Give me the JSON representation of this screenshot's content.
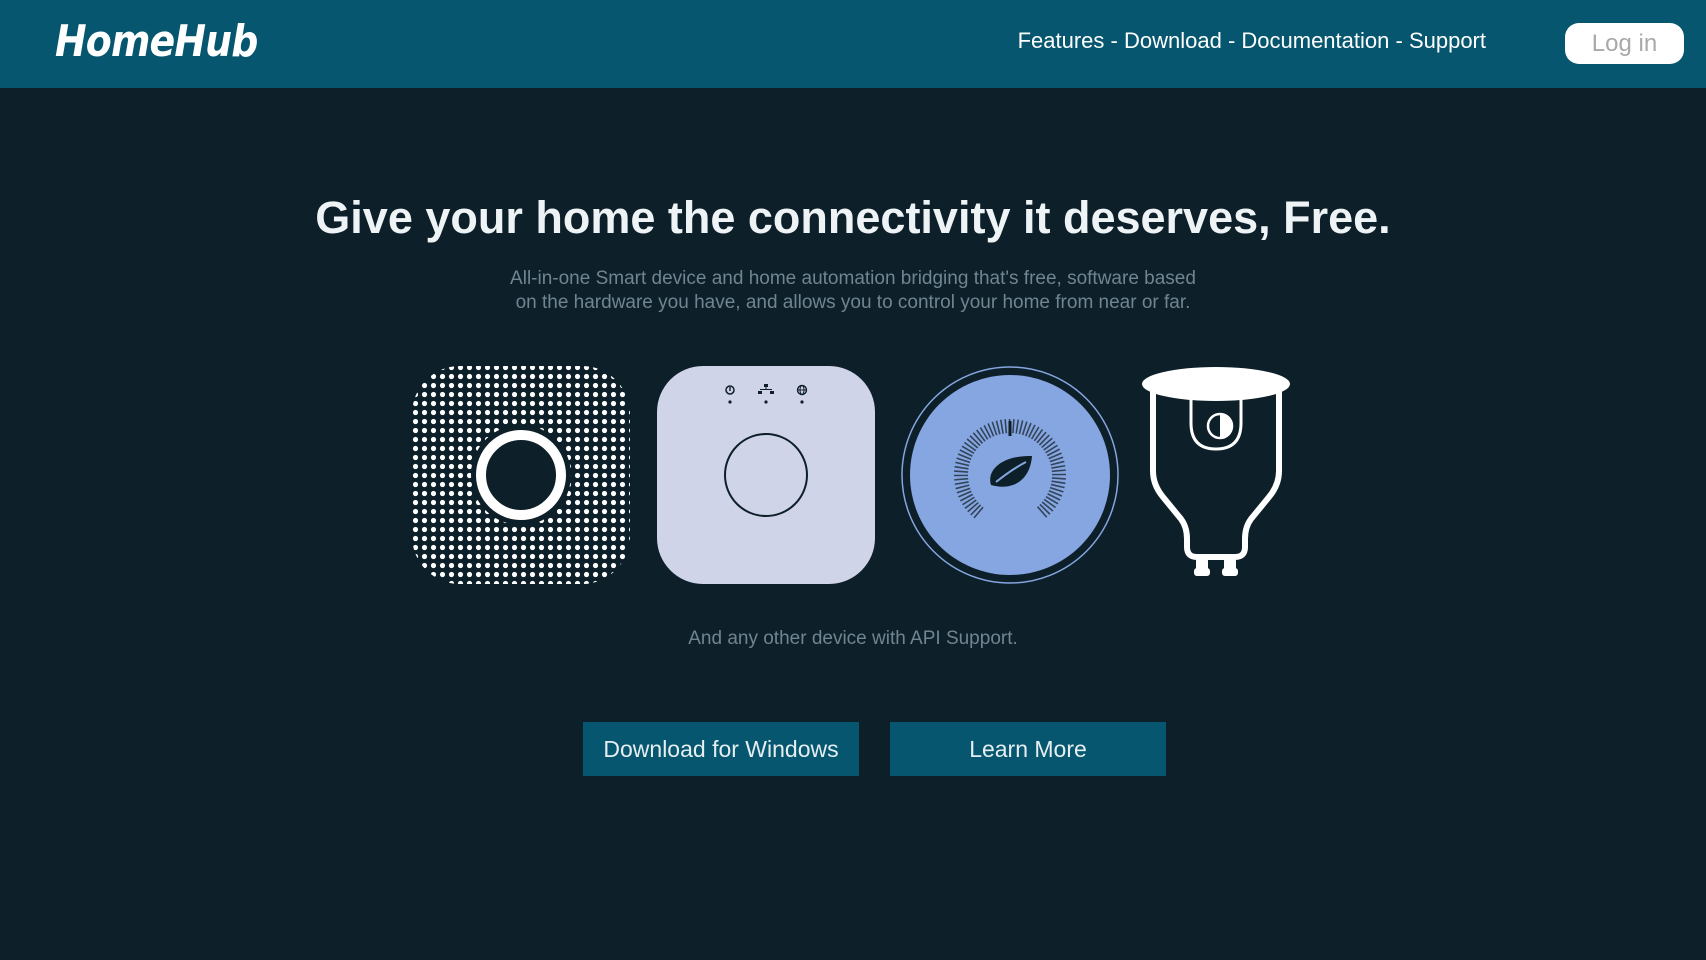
{
  "header": {
    "logo": "HomeHub",
    "nav": {
      "features": "Features",
      "download": "Download",
      "documentation": "Documentation",
      "support": "Support",
      "separator": " - "
    },
    "login_label": "Log in"
  },
  "hero": {
    "title": "Give your home the connectivity it deserves, Free.",
    "subtitle_line1": "All-in-one Smart device and home automation bridging that's free, software based",
    "subtitle_line2": "on the hardware you have, and allows you to control your home from near or far."
  },
  "devices": {
    "icons": [
      "smoke-detector-icon",
      "hub-bridge-icon",
      "thermostat-icon",
      "smart-bulb-icon"
    ],
    "caption": "And any other device with API Support."
  },
  "actions": {
    "download_label": "Download for Windows",
    "learn_more_label": "Learn More"
  },
  "colors": {
    "header_bg": "#05566e",
    "page_bg": "#0d1f28",
    "button_bg": "#05566e",
    "device_light": "#d0d4e8",
    "thermostat_blue": "#85a6e0"
  }
}
